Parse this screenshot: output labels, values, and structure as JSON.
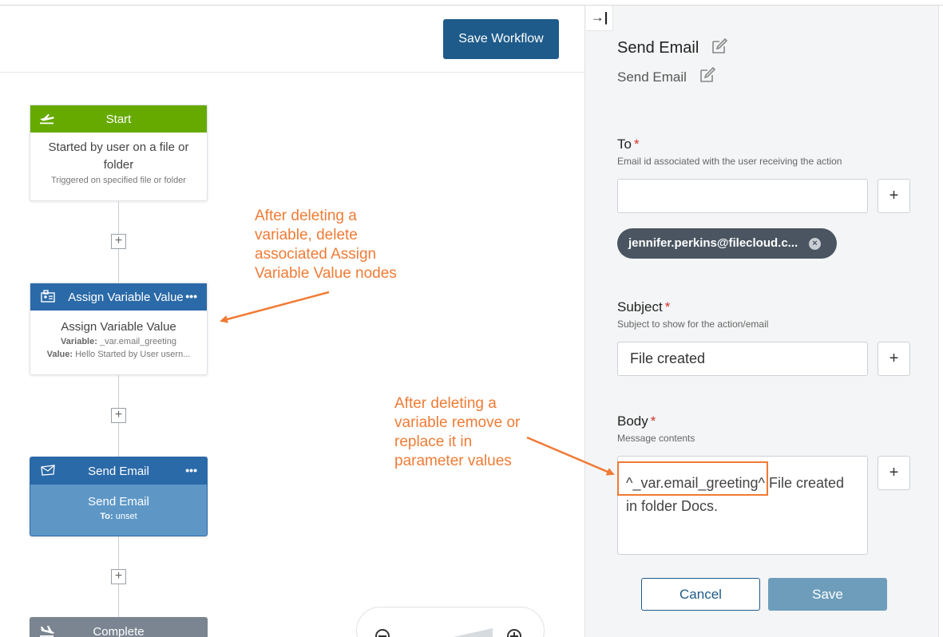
{
  "toolbar": {
    "save_workflow_label": "Save Workflow"
  },
  "colors": {
    "start_green": "#66aa00",
    "primary_blue": "#1e5b8a",
    "node_blue": "#2b6aa8",
    "complete_gray": "#7b8591",
    "annotation_orange": "#f07b35"
  },
  "nodes": {
    "start": {
      "title": "Start",
      "text": "Started by user on a file or folder",
      "subtext": "Triggered on specified file or folder",
      "icon": "plane-takeoff-icon"
    },
    "assign": {
      "title": "Assign Variable Value",
      "text": "Assign Variable Value",
      "variable_label": "Variable:",
      "variable_value": "_var.email_greeting",
      "value_label": "Value:",
      "value_value": "Hello Started by User usern...",
      "icon": "assign-variable-icon",
      "menu": "•••"
    },
    "send_email": {
      "title": "Send Email",
      "text": "Send Email",
      "to_label": "To:",
      "to_value": "unset",
      "icon": "email-icon",
      "menu": "•••"
    },
    "complete": {
      "title": "Complete",
      "icon": "plane-landing-icon"
    }
  },
  "add_button_glyph": "+",
  "annotations": {
    "a1": [
      "After deleting a",
      "variable, delete",
      "associated Assign",
      "Variable Value nodes"
    ],
    "a2": [
      "After deleting a",
      "variable remove or",
      "replace it in",
      "parameter values"
    ]
  },
  "panel": {
    "title": "Send Email",
    "subtitle": "Send Email",
    "to": {
      "label": "To",
      "required": "*",
      "help": "Email id associated with the user receiving the action",
      "value": "",
      "plus": "+",
      "chip": "jennifer.perkins@filecloud.c...",
      "chip_remove": "×"
    },
    "subject": {
      "label": "Subject",
      "required": "*",
      "help": "Subject to show for the action/email",
      "value": "File created",
      "plus": "+"
    },
    "body": {
      "label": "Body",
      "required": "*",
      "help": "Message contents",
      "value": "^_var.email_greeting^ File created in folder Docs.",
      "plus": "+"
    },
    "cancel_label": "Cancel",
    "save_label": "Save",
    "collapse_glyph": "→|"
  }
}
